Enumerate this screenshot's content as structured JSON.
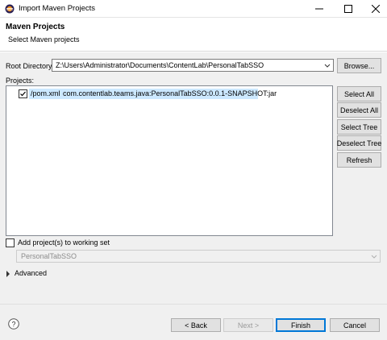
{
  "window": {
    "title": "Import Maven Projects",
    "minimize_icon": "minimize-icon",
    "maximize_icon": "maximize-icon",
    "close_icon": "close-icon"
  },
  "header": {
    "title": "Maven Projects",
    "subtitle": "Select Maven projects"
  },
  "root_directory": {
    "label": "Root Directory:",
    "value": "Z:\\Users\\Administrator\\Documents\\ContentLab\\PersonalTabSSO",
    "browse_label": "Browse..."
  },
  "projects": {
    "label": "Projects:",
    "items": [
      {
        "checked": true,
        "path": "/pom.xml",
        "artifact": "com.contentlab.teams.java:PersonalTabSSO:0.0.1-SNAPSHOT:jar"
      }
    ]
  },
  "side_buttons": {
    "select_all": "Select All",
    "deselect_all": "Deselect All",
    "select_tree": "Select Tree",
    "deselect_tree": "Deselect Tree",
    "refresh": "Refresh"
  },
  "working_set": {
    "checkbox_label": "Add project(s) to working set",
    "checked": false,
    "value": "PersonalTabSSO"
  },
  "advanced": {
    "label": "Advanced"
  },
  "footer": {
    "help_icon": "help-icon",
    "back": "< Back",
    "next": "Next >",
    "finish": "Finish",
    "cancel": "Cancel"
  }
}
